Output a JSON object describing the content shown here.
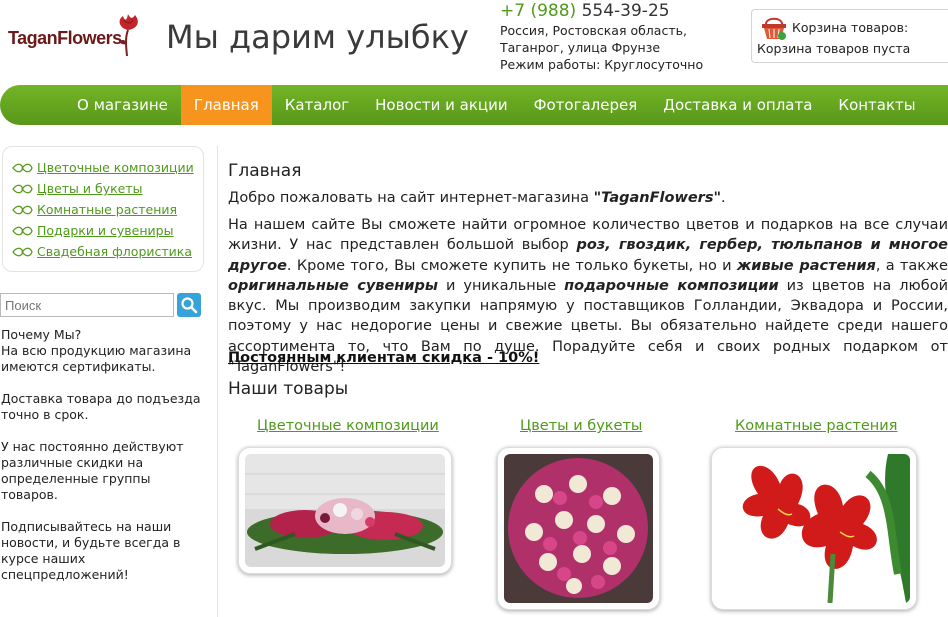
{
  "header": {
    "logo_text": "TaganFlowers",
    "slogan": "Мы дарим улыбку",
    "phone_code": "+7 (988)",
    "phone_number": "554-39-25",
    "address_line1": "Россия, Ростовская область,",
    "address_line2": "Таганрог, улица Фрунзе",
    "hours": "Режим работы: Круглосуточно",
    "cart_title": "Корзина товаров:",
    "cart_status": "Корзина товаров пуста"
  },
  "nav": [
    "О магазине",
    "Главная",
    "Каталог",
    "Новости и акции",
    "Фотогалерея",
    "Доставка и оплата",
    "Контакты"
  ],
  "sidebar": {
    "categories": [
      "Цветочные композиции",
      "Цветы и букеты",
      "Комнатные растения",
      "Подарки и сувениры",
      "Свадебная флористика"
    ],
    "search_placeholder": "Поиск",
    "why": [
      "Почему Мы?\nНа всю продукцию магазина имеются сертификаты.",
      "Доставка товара до подъезда точно в срок.",
      "У нас постоянно действуют различные скидки на определенные группы товаров.",
      "Подписывайтесь на наши новости, и будьте всегда в курсе наших спецпредложений!"
    ]
  },
  "main": {
    "title": "Главная",
    "welcome_prefix": "Добро пожаловать на сайт интернет-магазина ",
    "welcome_brand": "\"TaganFlowers\"",
    "welcome_suffix": ".",
    "text": {
      "t1": "На нашем сайте Вы сможете найти огромное количество цветов и подарков на все случаи жизни. У нас представлен большой выбор ",
      "b1": "роз, гвоздик, гербер, тюльпанов и многое другое",
      "t2": ". Кроме того, Вы сможете купить не только букеты, но и ",
      "b2": "живые растения",
      "t3": ", а также ",
      "b3": "оригинальные сувениры",
      "t4": " и уникальные ",
      "b4": "подарочные композиции",
      "t5": " из цветов на любой вкус. Мы производим закупки напрямую у поставщиков Голландии, Эквадора и России, поэтому у нас недорогие цены и свежие цветы. Вы обязательно найдете среди нашего ассортимента то, что Вам по душе. Порадуйте себя и своих родных подарком от \"TaganFlowers\"!"
    },
    "discount": "Постоянным клиентам скидка - 10%!",
    "products_title": "Наши товары",
    "products": [
      "Цветочные композиции",
      "Цветы и букеты",
      "Комнатные растения"
    ]
  },
  "colors": {
    "accent_green": "#4f9a1b",
    "nav_green": "#64a61f",
    "nav_active": "#f7941d",
    "search_blue": "#36a3d9"
  }
}
